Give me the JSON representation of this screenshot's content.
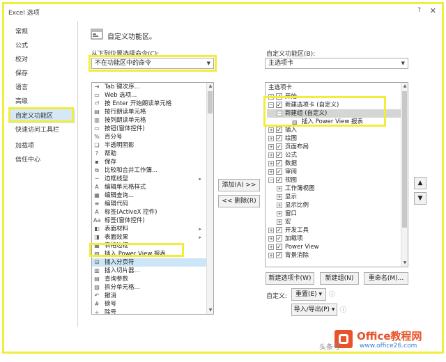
{
  "window": {
    "title": "Excel 选项",
    "help": "?",
    "close": "✕"
  },
  "sidebar": {
    "items": [
      {
        "label": "常规"
      },
      {
        "label": "公式"
      },
      {
        "label": "校对"
      },
      {
        "label": "保存"
      },
      {
        "label": "语言"
      },
      {
        "label": "高级"
      },
      {
        "label": "自定义功能区"
      },
      {
        "label": "快速访问工具栏"
      },
      {
        "label": "加载项"
      },
      {
        "label": "信任中心"
      }
    ],
    "selected": "自定义功能区"
  },
  "header": {
    "title": "自定义功能区。"
  },
  "left": {
    "label": "从下列位置选择命令(C):",
    "combo_value": "不在功能区中的命令",
    "commands": [
      {
        "icon": "tab-order-icon",
        "label": "Tab 键次序..."
      },
      {
        "icon": "web-options-icon",
        "label": "Web 选项..."
      },
      {
        "icon": "enter-read-icon",
        "label": "按 Enter 开始朗读单元格"
      },
      {
        "icon": "read-row-icon",
        "label": "按行朗读单元格"
      },
      {
        "icon": "read-col-icon",
        "label": "按列朗读单元格"
      },
      {
        "icon": "button-icon",
        "label": "按钮(窗体控件)"
      },
      {
        "icon": "percent-icon",
        "label": "百分号"
      },
      {
        "icon": "semi-transparent-shadow-icon",
        "label": "半透明阴影"
      },
      {
        "icon": "help-icon",
        "label": "帮助"
      },
      {
        "icon": "save-icon",
        "label": "保存"
      },
      {
        "icon": "compare-merge-icon",
        "label": "比较和合并工作簿..."
      },
      {
        "icon": "border-line-icon",
        "label": "边框线型",
        "submenu": true
      },
      {
        "icon": "edit-cell-style-icon",
        "label": "编辑单元格样式"
      },
      {
        "icon": "edit-query-icon",
        "label": "编辑查询..."
      },
      {
        "icon": "edit-code-icon",
        "label": "编辑代码"
      },
      {
        "icon": "label-activex-icon",
        "label": "标签(ActiveX 控件)"
      },
      {
        "icon": "label-form-icon",
        "label": "标签(窗体控件)"
      },
      {
        "icon": "surface-material-icon",
        "label": "表面材料",
        "submenu": true
      },
      {
        "icon": "surface-effect-icon",
        "label": "表面效果",
        "submenu": true
      },
      {
        "icon": "table-border-icon",
        "label": "表格边框"
      },
      {
        "icon": "power-view-icon",
        "label": "插入 Power View 报表"
      },
      {
        "icon": "insert-page-break-icon",
        "label": "插入分页符"
      },
      {
        "icon": "insert-slicer-icon",
        "label": "插入切片器..."
      },
      {
        "icon": "query-params-icon",
        "label": "查询参数"
      },
      {
        "icon": "split-cells-icon",
        "label": "拆分单元格..."
      },
      {
        "icon": "undo-icon",
        "label": "撤消"
      },
      {
        "icon": "hash-icon",
        "label": "磅号"
      },
      {
        "icon": "division-icon",
        "label": "除号"
      }
    ],
    "selected_index": 21
  },
  "middle": {
    "add": "添加(A) >>",
    "remove": "<< 删除(R)"
  },
  "right": {
    "label": "自定义功能区(B):",
    "combo_value": "主选项卡",
    "tree_header": "主选项卡",
    "tree": [
      {
        "indent": 0,
        "exp": "⊞",
        "check": true,
        "label": "开始"
      },
      {
        "indent": 0,
        "exp": "⊟",
        "check": true,
        "label": "新建选项卡 (自定义)"
      },
      {
        "indent": 1,
        "exp": "⊟",
        "check": null,
        "label": "新建组 (自定义)",
        "sel": true
      },
      {
        "indent": 2,
        "exp": "",
        "check": null,
        "label": "插入 Power View 报表",
        "icon": true
      },
      {
        "indent": 0,
        "exp": "⊞",
        "check": true,
        "label": "插入"
      },
      {
        "indent": 0,
        "exp": "⊞",
        "check": true,
        "label": "绘图"
      },
      {
        "indent": 0,
        "exp": "⊞",
        "check": true,
        "label": "页面布局"
      },
      {
        "indent": 0,
        "exp": "⊞",
        "check": true,
        "label": "公式"
      },
      {
        "indent": 0,
        "exp": "⊞",
        "check": true,
        "label": "数据"
      },
      {
        "indent": 0,
        "exp": "⊞",
        "check": true,
        "label": "审阅"
      },
      {
        "indent": 0,
        "exp": "⊟",
        "check": true,
        "label": "视图"
      },
      {
        "indent": 1,
        "exp": "⊞",
        "check": null,
        "label": "工作簿视图"
      },
      {
        "indent": 1,
        "exp": "⊞",
        "check": null,
        "label": "显示"
      },
      {
        "indent": 1,
        "exp": "⊞",
        "check": null,
        "label": "显示比例"
      },
      {
        "indent": 1,
        "exp": "⊞",
        "check": null,
        "label": "窗口"
      },
      {
        "indent": 1,
        "exp": "⊞",
        "check": null,
        "label": "宏"
      },
      {
        "indent": 0,
        "exp": "⊞",
        "check": true,
        "label": "开发工具"
      },
      {
        "indent": 0,
        "exp": "⊞",
        "check": true,
        "label": "加载项"
      },
      {
        "indent": 0,
        "exp": "⊞",
        "check": true,
        "label": "Power View"
      },
      {
        "indent": 0,
        "exp": "⊞",
        "check": true,
        "label": "背景消除"
      }
    ],
    "new_tab": "新建选项卡(W)",
    "new_group": "新建组(N)",
    "rename": "重命名(M)...",
    "customize_label": "自定义:",
    "reset": "重置(E) ▾",
    "import_export": "导入/导出(P) ▾",
    "info": "ⓘ"
  },
  "watermark": {
    "brand": "Office教程网",
    "url": "www.office26.com",
    "head": "头条号"
  }
}
